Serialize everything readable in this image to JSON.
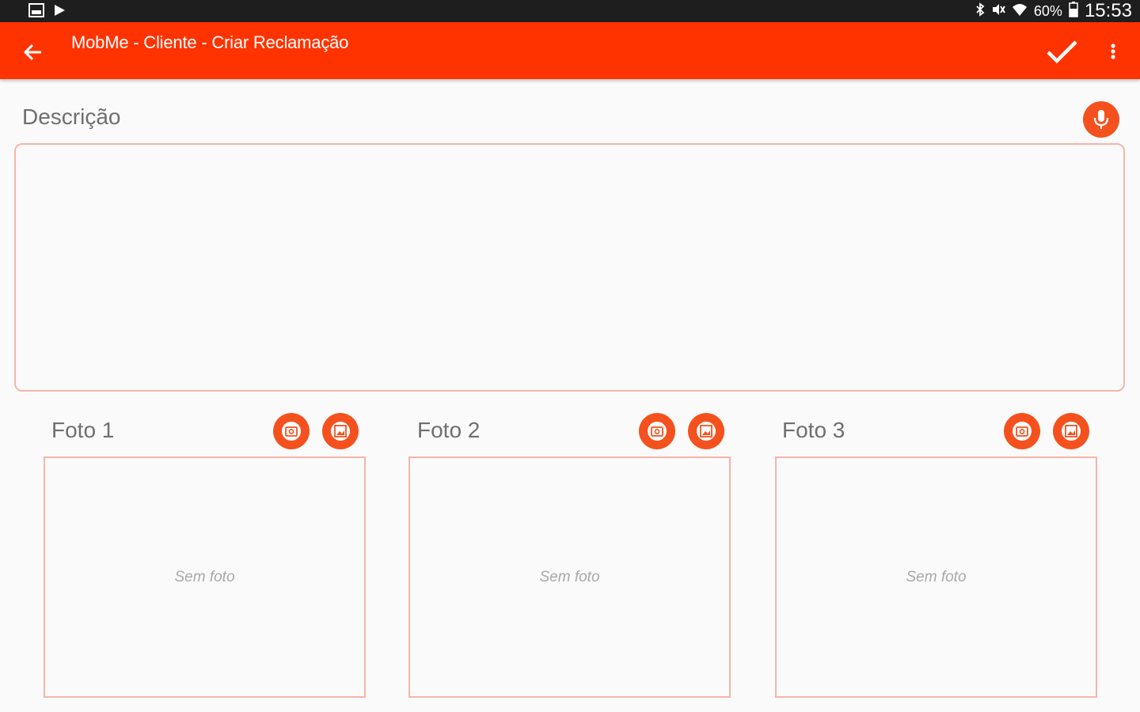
{
  "status_bar": {
    "battery_percent": "60%",
    "clock": "15:53",
    "left_icons": [
      "gallery-notification-icon",
      "play-store-icon"
    ],
    "right_icons": [
      "bluetooth-icon",
      "mute-icon",
      "wifi-icon",
      "battery-icon"
    ]
  },
  "app_bar": {
    "title": "MobMe - Cliente - Criar Reclamação",
    "background_color": "#ff3300",
    "icons": [
      "arrow-back-icon",
      "check-icon",
      "more-vert-icon"
    ]
  },
  "description": {
    "label": "Descrição",
    "value": "",
    "mic_icon": "mic-icon"
  },
  "photos": [
    {
      "label": "Foto 1",
      "empty_text": "Sem foto"
    },
    {
      "label": "Foto 2",
      "empty_text": "Sem foto"
    },
    {
      "label": "Foto 3",
      "empty_text": "Sem foto"
    }
  ],
  "colors": {
    "accent": "#f4511e",
    "border": "#f6b5a8"
  }
}
